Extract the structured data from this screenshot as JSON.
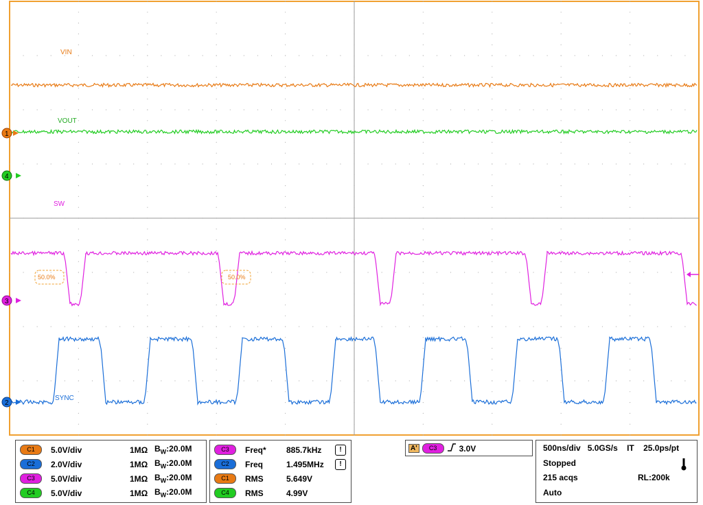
{
  "traces": {
    "vin_label": "VIN",
    "vout_label": "VOUT",
    "sw_label": "SW",
    "sync_label": "SYNC",
    "cursor1_label": "50.0%",
    "cursor2_label": "50.0%"
  },
  "markers": {
    "ch1": "1",
    "ch2": "2",
    "ch3": "3",
    "ch4": "4"
  },
  "channels": [
    {
      "id": "C1",
      "scale": "5.0V/div",
      "impedance": "1MΩ",
      "bw_prefix": "B",
      "bw_sub": "W",
      "bw_value": ":20.0M",
      "color": "#e87a14"
    },
    {
      "id": "C2",
      "scale": "2.0V/div",
      "impedance": "1MΩ",
      "bw_prefix": "B",
      "bw_sub": "W",
      "bw_value": ":20.0M",
      "color": "#1a6ed8"
    },
    {
      "id": "C3",
      "scale": "5.0V/div",
      "impedance": "1MΩ",
      "bw_prefix": "B",
      "bw_sub": "W",
      "bw_value": ":20.0M",
      "color": "#e020e0"
    },
    {
      "id": "C4",
      "scale": "5.0V/div",
      "impedance": "1MΩ",
      "bw_prefix": "B",
      "bw_sub": "W",
      "bw_value": ":20.0M",
      "color": "#22cc22"
    }
  ],
  "measurements": [
    {
      "ch": "C3",
      "name": "Freq*",
      "value": "885.7kHz",
      "icon": "measurement-warning-icon",
      "color": "#e020e0"
    },
    {
      "ch": "C2",
      "name": "Freq",
      "value": "1.495MHz",
      "icon": "measurement-warning-icon",
      "color": "#1a6ed8"
    },
    {
      "ch": "C1",
      "name": "RMS",
      "value": "5.649V",
      "icon": "",
      "color": "#e87a14"
    },
    {
      "ch": "C4",
      "name": "RMS",
      "value": "4.99V",
      "icon": "",
      "color": "#22cc22"
    }
  ],
  "trigger": {
    "mode": "A'",
    "source": "C3",
    "slope_icon": "rising-edge-icon",
    "level": "3.0V"
  },
  "timebase": {
    "horizontal": "500ns/div",
    "sample_rate": "5.0GS/s",
    "mode": "IT",
    "resolution": "25.0ps/pt",
    "state": "Stopped",
    "acqs": "215 acqs",
    "record_length": "RL:200k",
    "trigger_mode": "Auto"
  },
  "colors": {
    "vin": "#e87a14",
    "vout": "#22cc22",
    "sw": "#e020e0",
    "sync": "#1a6ed8",
    "graticule": "#b0b0b0",
    "frame": "#f0a030"
  }
}
